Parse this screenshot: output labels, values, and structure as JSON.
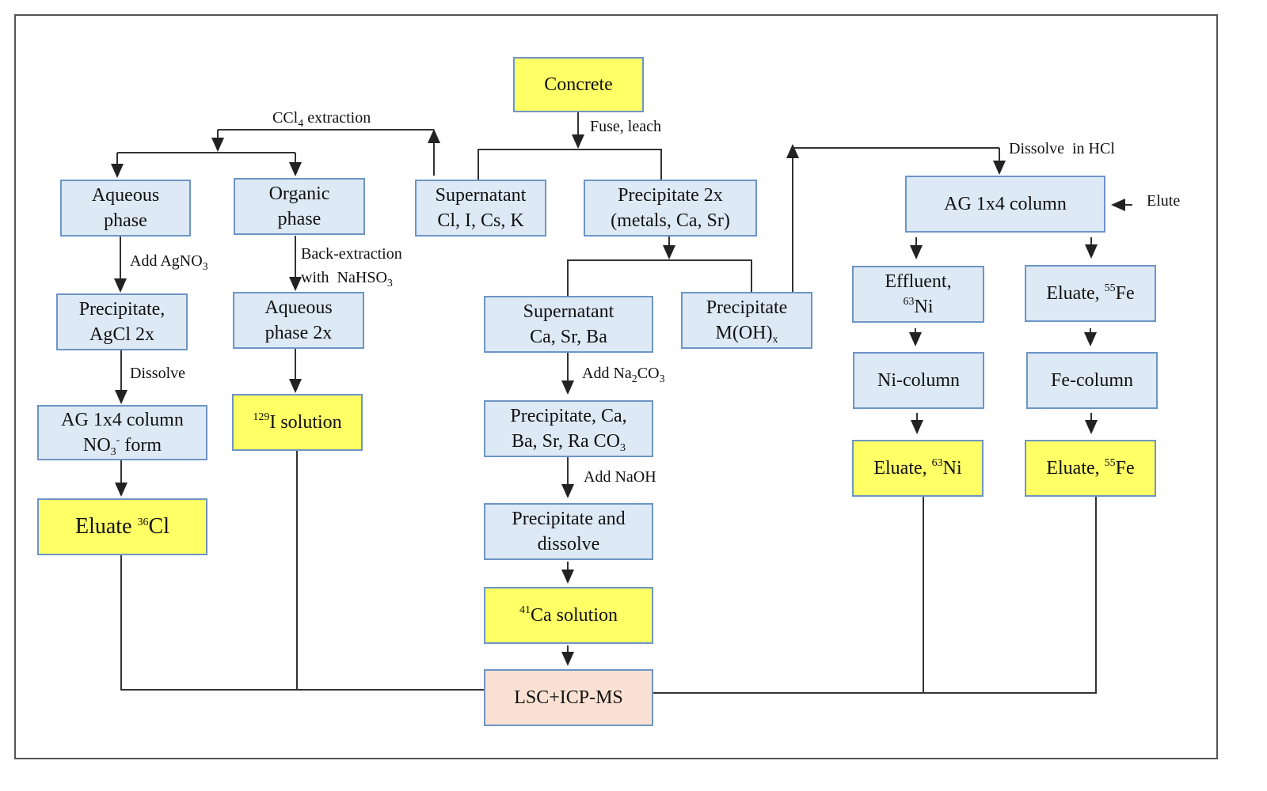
{
  "colors": {
    "process_box": "#dde9f5",
    "process_border": "#6d95c6",
    "product_box": "#ffff66",
    "measurement_box": "#fbe1d3"
  },
  "nodes": {
    "concrete": "Concrete",
    "aqueous_phase": [
      "Aqueous",
      "phase"
    ],
    "organic_phase": [
      "Organic",
      "phase"
    ],
    "supernatant_1": [
      "Supernatant",
      "Cl, I, Cs, K"
    ],
    "precipitate_2x": [
      "Precipitate 2x",
      "(metals, Ca, Sr)"
    ],
    "ag_column_right": "AG 1x4 column",
    "precipitate_agcl": [
      "Precipitate,",
      "AgCl 2x"
    ],
    "aqueous_phase_2x": [
      "Aqueous",
      "phase 2x"
    ],
    "supernatant_ca": [
      "Supernatant",
      "Ca, Sr, Ba"
    ],
    "precipitate_moh": {
      "line1": "Precipitate",
      "line2": "M(OH)",
      "sub": "x"
    },
    "effluent_ni": {
      "line1": "Effluent,",
      "sup": "63",
      "el": "Ni"
    },
    "eluate_fe": {
      "text": "Eluate, ",
      "sup": "55",
      "el": "Fe"
    },
    "ag_column_left": {
      "line1": "AG 1x4 column",
      "line2a": "NO",
      "sub": "3",
      "sup": "-",
      "line2b": " form"
    },
    "iodine_solution": {
      "sup": "129",
      "text": "I solution"
    },
    "precipitate_ca": {
      "line1": "Precipitate, Ca,",
      "line2": "Ba, Sr, Ra CO",
      "sub": "3"
    },
    "ni_column": "Ni-column",
    "fe_column": "Fe-column",
    "eluate_cl": {
      "text": "Eluate ",
      "sup": "36",
      "el": "Cl"
    },
    "eluate_ni_final": {
      "text": "Eluate, ",
      "sup": "63",
      "el": "Ni"
    },
    "eluate_fe_final": {
      "text": "Eluate, ",
      "sup": "55",
      "el": "Fe"
    },
    "precipitate_dissolve": [
      "Precipitate and",
      "dissolve"
    ],
    "calcium_solution": {
      "sup": "41",
      "text": "Ca solution"
    },
    "lsc_icpms": "LSC+ICP-MS"
  },
  "edge_labels": {
    "fuse_leach": "Fuse, leach",
    "ccl4": {
      "a": "CCl",
      "sub": "4",
      "b": " extraction"
    },
    "add_agno3": {
      "a": "Add AgNO",
      "sub": "3"
    },
    "back_extraction": {
      "line1": "Back-extraction",
      "line2": "with  NaHSO",
      "sub": "3"
    },
    "dissolve": "Dissolve",
    "dissolve_hcl": "Dissolve  in HCl",
    "elute": "Elute",
    "add_na2co3": {
      "a": "Add Na",
      "sub1": "2",
      "b": "CO",
      "sub2": "3"
    },
    "add_naoh": "Add NaOH"
  }
}
